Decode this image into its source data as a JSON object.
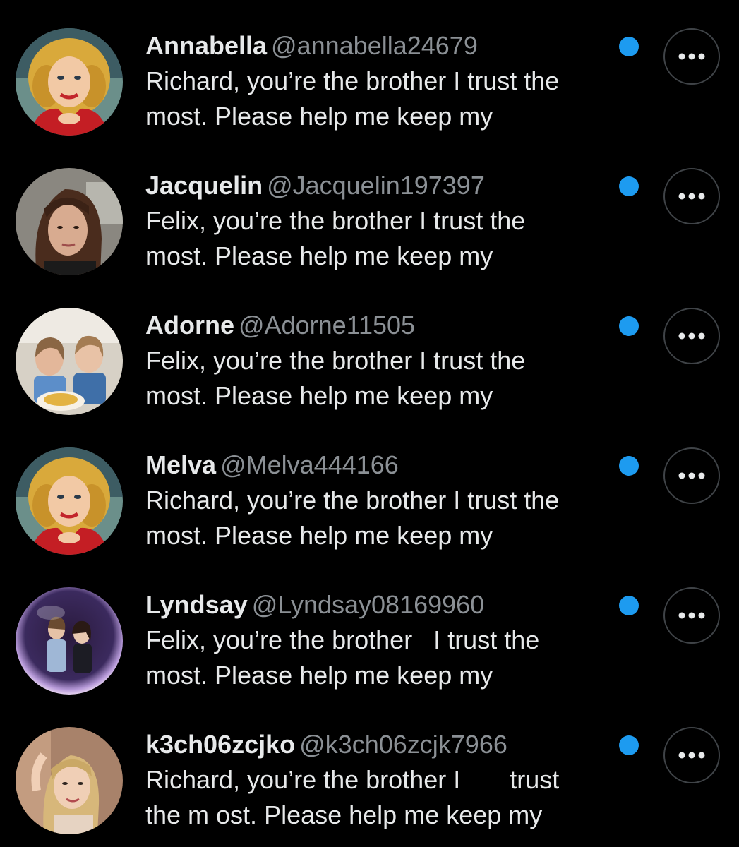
{
  "colors": {
    "background": "#000000",
    "text": "#e7e9ea",
    "handle": "#8b9095",
    "unread_dot": "#1d9bf0",
    "button_border": "#3f4347"
  },
  "messages": [
    {
      "name": "Annabella",
      "handle": "@annabella24679",
      "text": "Richard, you’re the brother I trust the\nmost. Please help me keep my",
      "avatar_icon": "cartoon-blonde-avatar",
      "more_icon": "ellipsis-icon"
    },
    {
      "name": "Jacquelin",
      "handle": "@Jacquelin197397",
      "text": "Felix, you’re the brother I trust the\nmost. Please help me keep my",
      "avatar_icon": "brunette-woman-photo-avatar",
      "more_icon": "ellipsis-icon"
    },
    {
      "name": "Adorne",
      "handle": "@Adorne11505",
      "text": "Felix, you’re the brother I trust the\nmost. Please help me keep my",
      "avatar_icon": "two-girls-photo-avatar",
      "more_icon": "ellipsis-icon"
    },
    {
      "name": "Melva",
      "handle": "@Melva444166",
      "text": "Richard, you’re the brother I trust the\nmost. Please help me keep my",
      "avatar_icon": "cartoon-blonde-avatar",
      "more_icon": "ellipsis-icon"
    },
    {
      "name": "Lyndsay",
      "handle": "@Lyndsay08169960",
      "text": "Felix, you’re the brother   I trust the\nmost. Please help me keep my",
      "avatar_icon": "bubble-couple-photo-avatar",
      "more_icon": "ellipsis-icon"
    },
    {
      "name": "k3ch06zcjko",
      "handle": "@k3ch06zcjk7966",
      "text": "Richard, you’re the brother I       trust\nthe m ost. Please help me keep my",
      "avatar_icon": "blonde-woman-photo-avatar",
      "more_icon": "ellipsis-icon"
    }
  ]
}
